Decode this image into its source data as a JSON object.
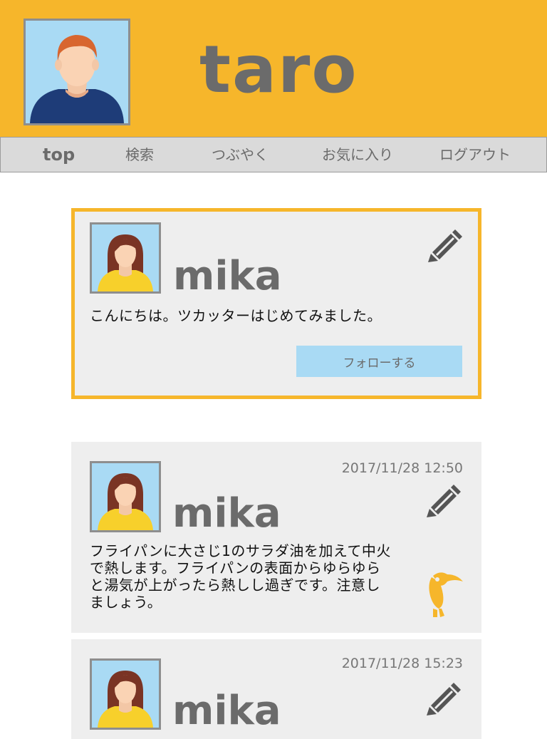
{
  "header": {
    "username": "taro",
    "avatar_icon": "male-avatar-icon",
    "background": "#f6b62b"
  },
  "nav": {
    "items": [
      {
        "label": "top"
      },
      {
        "label": "検索"
      },
      {
        "label": "つぶやく"
      },
      {
        "label": "お気に入り"
      },
      {
        "label": "ログアウト"
      }
    ]
  },
  "profile_card": {
    "name": "mika",
    "text": "こんにちは。ツカッターはじめてみました。",
    "follow_label": "フォローする",
    "edit_icon": "pencil-icon"
  },
  "posts": [
    {
      "name": "mika",
      "date": "2017/11/28 12:50",
      "lines": [
        "フライパンに大さじ1のサラダ油を加えて中火",
        "で熱します。フライパンの表面からゆらゆら",
        "と湯気が上がったら熱しし過ぎです。注意し",
        "ましょう。"
      ],
      "edit_icon": "pencil-icon",
      "badge_icon": "toucan-icon"
    },
    {
      "name": "mika",
      "date": "2017/11/28 15:23",
      "edit_icon": "pencil-icon"
    }
  ],
  "colors": {
    "accent": "#f6b62b",
    "avatar_bg": "#a9daf4",
    "text_gray": "#6b6b6b",
    "card_bg": "#eeeeee"
  }
}
